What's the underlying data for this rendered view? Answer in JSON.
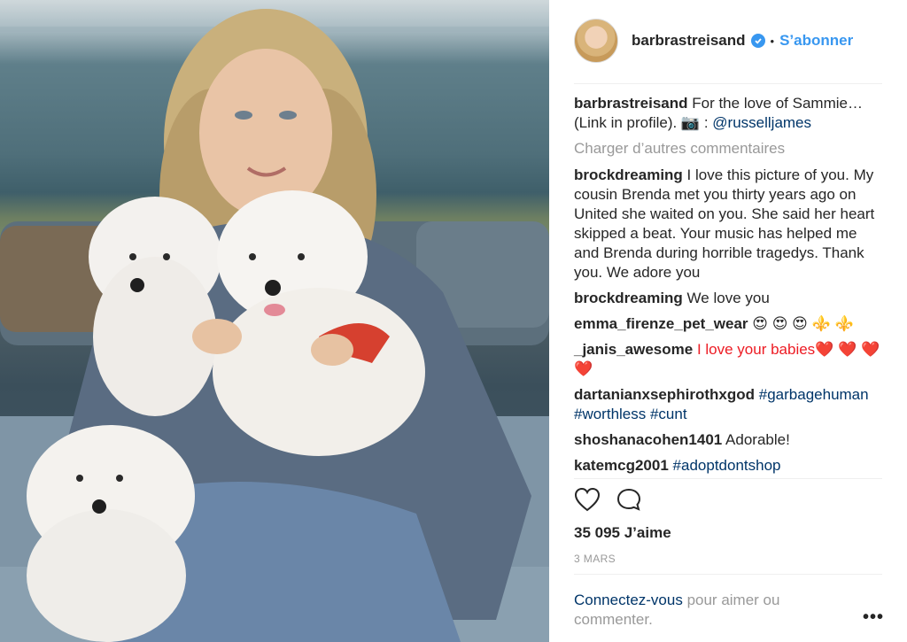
{
  "post": {
    "photo_alt": "",
    "header": {
      "username": "barbrastreisand",
      "verified": true,
      "follow_label": "S’abonner"
    },
    "caption": {
      "username": "barbrastreisand",
      "text": "For the love of Sammie…(Link in profile). 📷 : ",
      "mention": "@russelljames"
    },
    "load_more_label": "Charger d’autres commentaires",
    "comments": [
      {
        "user": "brockdreaming",
        "text": "I love this picture of you. My cousin Brenda met you thirty years ago on United she waited on you. She said her heart skipped a beat. Your music has helped me and Brenda during horrible tragedys. Thank you. We adore you"
      },
      {
        "user": "brockdreaming",
        "text": "We love you"
      },
      {
        "user": "emma_firenze_pet_wear",
        "text": "😍 😍 😍 ⚜️ ⚜️"
      },
      {
        "user": "_janis_awesome",
        "text": "I love your babies❤️ ❤️ ❤️ ❤️"
      },
      {
        "user": "dartanianxsephirothxgod",
        "tags": "#garbagehuman #worthless #cunt"
      },
      {
        "user": "shoshanacohen1401",
        "text": "Adorable!"
      },
      {
        "user": "katemcg2001",
        "tags": "#adoptdontshop"
      }
    ],
    "likes": "35 095 J’aime",
    "date": "3 MARS",
    "login": {
      "link": "Connectez-vous",
      "text": " pour aimer ou commenter."
    },
    "icons": {
      "like": "heart-icon",
      "comment": "comment-icon",
      "more": "more-options-icon",
      "verified": "verified-badge-icon"
    },
    "colors": {
      "accent": "#3897f0",
      "link": "#003569",
      "muted": "#999999",
      "text": "#262626"
    }
  }
}
